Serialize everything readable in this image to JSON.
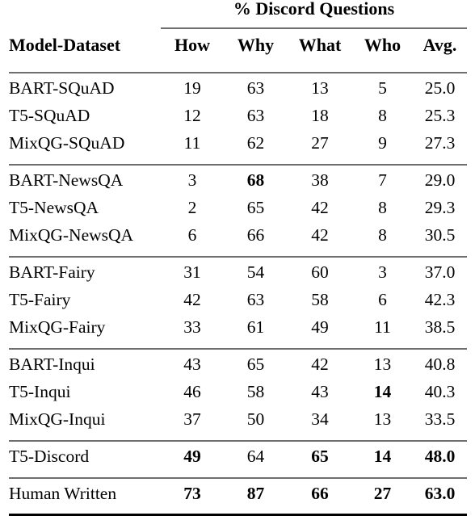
{
  "table": {
    "group_header": "% Discord Questions",
    "row_header_label": "Model-Dataset",
    "columns": [
      "How",
      "Why",
      "What",
      "Who",
      "Avg."
    ],
    "blocks": [
      {
        "name": "squad",
        "rows": [
          {
            "model": "BART-SQuAD",
            "how": "19",
            "why": "63",
            "what": "13",
            "who": "5",
            "avg": "25.0",
            "bold": {
              "how": false,
              "why": false,
              "what": false,
              "who": false,
              "avg": false
            }
          },
          {
            "model": "T5-SQuAD",
            "how": "12",
            "why": "63",
            "what": "18",
            "who": "8",
            "avg": "25.3",
            "bold": {
              "how": false,
              "why": false,
              "what": false,
              "who": false,
              "avg": false
            }
          },
          {
            "model": "MixQG-SQuAD",
            "how": "11",
            "why": "62",
            "what": "27",
            "who": "9",
            "avg": "27.3",
            "bold": {
              "how": false,
              "why": false,
              "what": false,
              "who": false,
              "avg": false
            }
          }
        ]
      },
      {
        "name": "newsqa",
        "rows": [
          {
            "model": "BART-NewsQA",
            "how": "3",
            "why": "68",
            "what": "38",
            "who": "7",
            "avg": "29.0",
            "bold": {
              "how": false,
              "why": true,
              "what": false,
              "who": false,
              "avg": false
            }
          },
          {
            "model": "T5-NewsQA",
            "how": "2",
            "why": "65",
            "what": "42",
            "who": "8",
            "avg": "29.3",
            "bold": {
              "how": false,
              "why": false,
              "what": false,
              "who": false,
              "avg": false
            }
          },
          {
            "model": "MixQG-NewsQA",
            "how": "6",
            "why": "66",
            "what": "42",
            "who": "8",
            "avg": "30.5",
            "bold": {
              "how": false,
              "why": false,
              "what": false,
              "who": false,
              "avg": false
            }
          }
        ]
      },
      {
        "name": "fairy",
        "rows": [
          {
            "model": "BART-Fairy",
            "how": "31",
            "why": "54",
            "what": "60",
            "who": "3",
            "avg": "37.0",
            "bold": {
              "how": false,
              "why": false,
              "what": false,
              "who": false,
              "avg": false
            }
          },
          {
            "model": "T5-Fairy",
            "how": "42",
            "why": "63",
            "what": "58",
            "who": "6",
            "avg": "42.3",
            "bold": {
              "how": false,
              "why": false,
              "what": false,
              "who": false,
              "avg": false
            }
          },
          {
            "model": "MixQG-Fairy",
            "how": "33",
            "why": "61",
            "what": "49",
            "who": "11",
            "avg": "38.5",
            "bold": {
              "how": false,
              "why": false,
              "what": false,
              "who": false,
              "avg": false
            }
          }
        ]
      },
      {
        "name": "inqui",
        "rows": [
          {
            "model": "BART-Inqui",
            "how": "43",
            "why": "65",
            "what": "42",
            "who": "13",
            "avg": "40.8",
            "bold": {
              "how": false,
              "why": false,
              "what": false,
              "who": false,
              "avg": false
            }
          },
          {
            "model": "T5-Inqui",
            "how": "46",
            "why": "58",
            "what": "43",
            "who": "14",
            "avg": "40.3",
            "bold": {
              "how": false,
              "why": false,
              "what": false,
              "who": true,
              "avg": false
            }
          },
          {
            "model": "MixQG-Inqui",
            "how": "37",
            "why": "50",
            "what": "34",
            "who": "13",
            "avg": "33.5",
            "bold": {
              "how": false,
              "why": false,
              "what": false,
              "who": false,
              "avg": false
            }
          }
        ]
      },
      {
        "name": "discord",
        "rows": [
          {
            "model": "T5-Discord",
            "how": "49",
            "why": "64",
            "what": "65",
            "who": "14",
            "avg": "48.0",
            "bold": {
              "how": true,
              "why": false,
              "what": true,
              "who": true,
              "avg": true
            }
          }
        ]
      },
      {
        "name": "human",
        "rows": [
          {
            "model": "Human Written",
            "how": "73",
            "why": "87",
            "what": "66",
            "who": "27",
            "avg": "63.0",
            "bold": {
              "how": true,
              "why": true,
              "what": true,
              "who": true,
              "avg": true
            }
          }
        ]
      }
    ]
  },
  "colors": {
    "rule_light": "#6e6e6e",
    "rule_dark": "#000000",
    "text": "#000000",
    "background": "#ffffff"
  }
}
